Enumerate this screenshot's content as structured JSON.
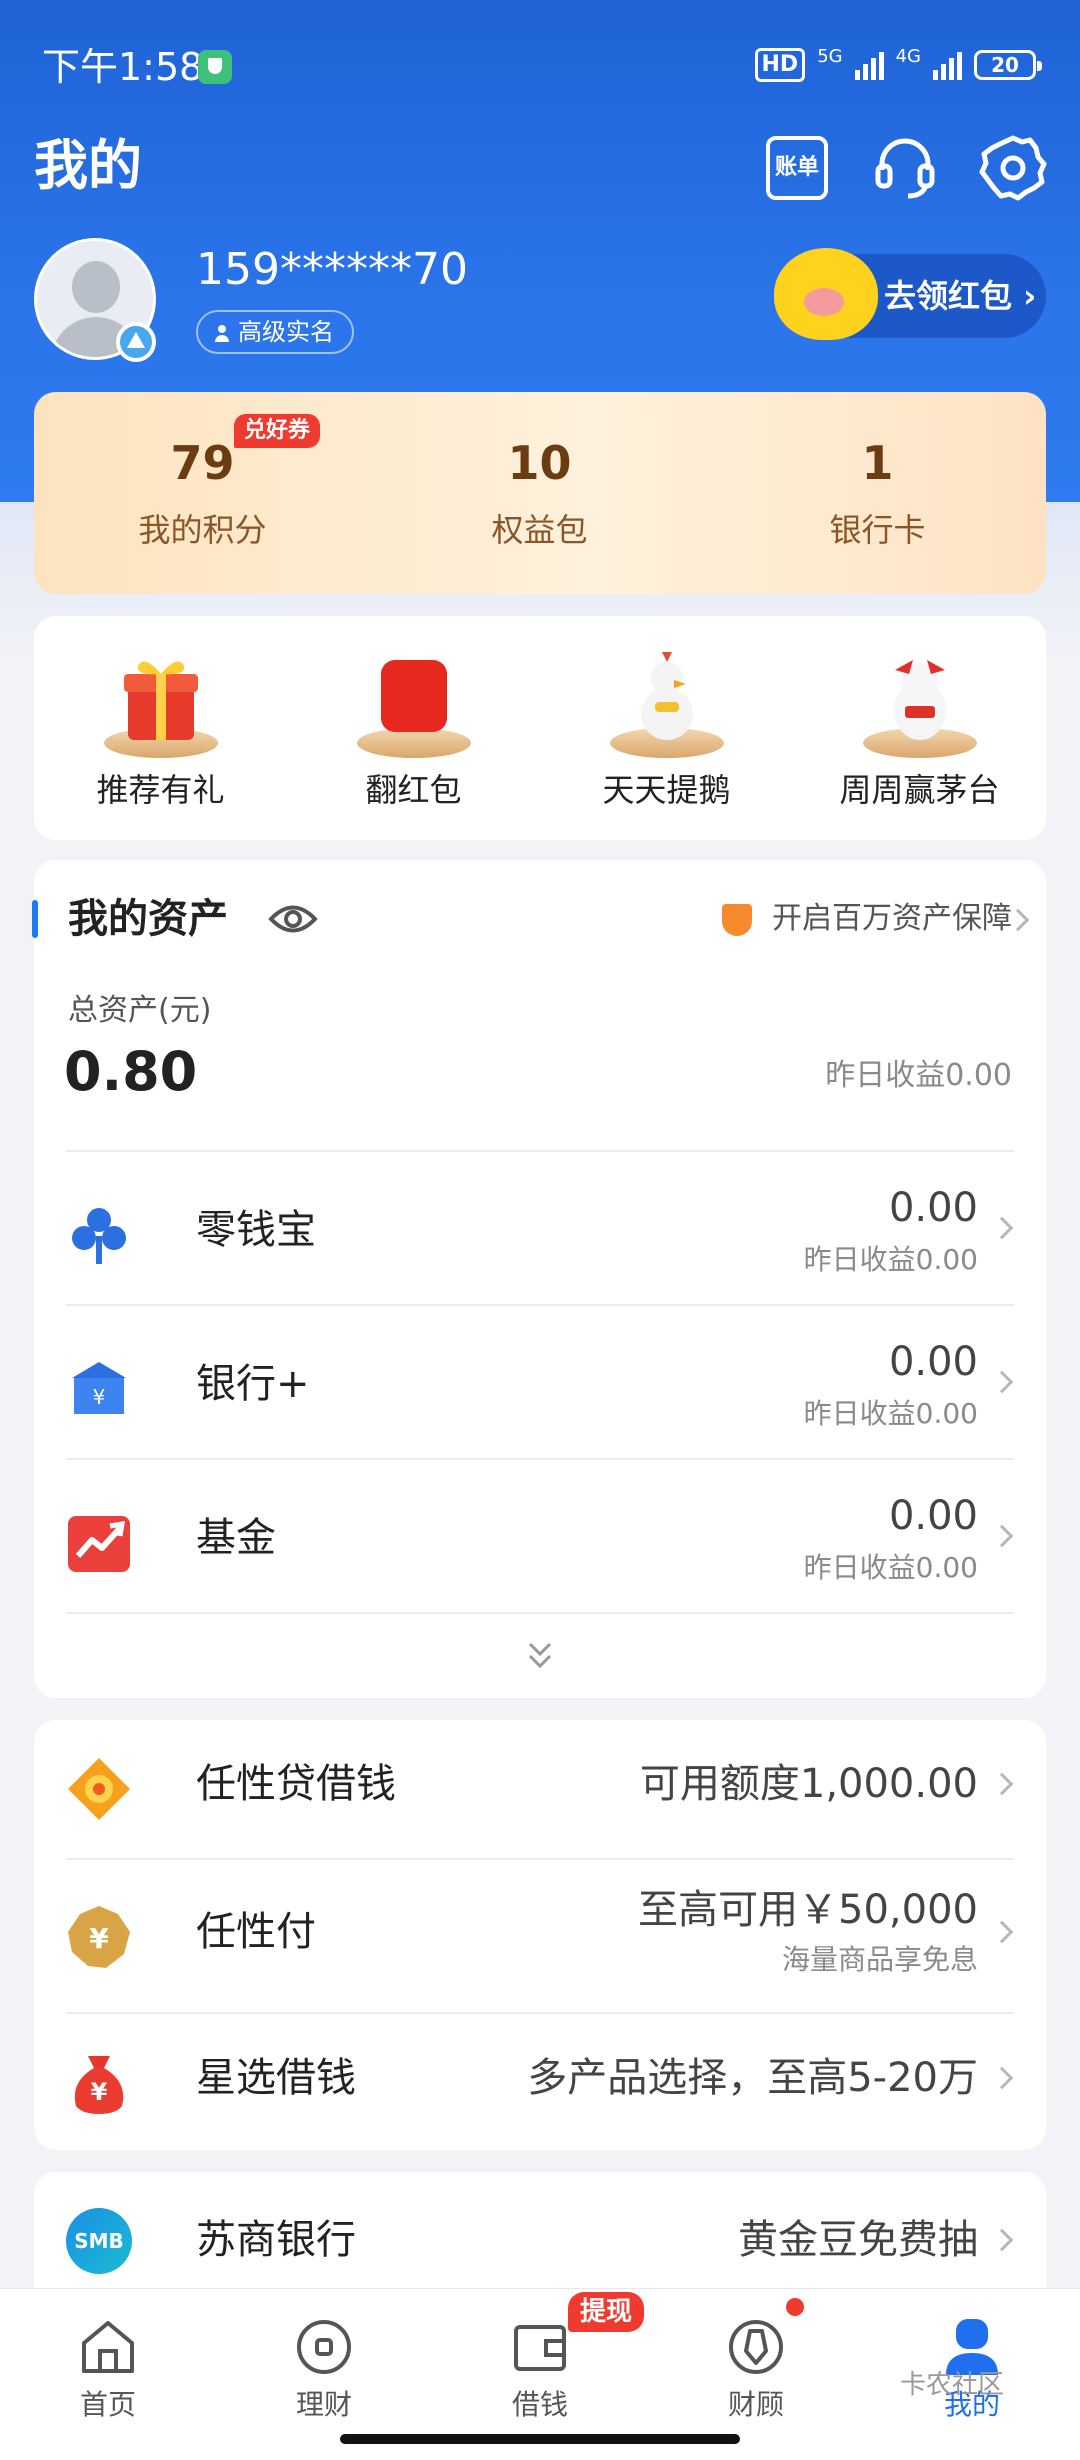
{
  "status_bar": {
    "time": "下午1:58",
    "hd": "HD",
    "network_1": "5G",
    "network_2": "4G",
    "battery": "20"
  },
  "header": {
    "title": "我的",
    "bill_label": "账单"
  },
  "profile": {
    "phone": "159******70",
    "verify_label": "高级实名",
    "redpacket_label": "去领红包"
  },
  "stats": [
    {
      "value": "79",
      "label": "我的积分",
      "badge": "兑好券"
    },
    {
      "value": "10",
      "label": "权益包"
    },
    {
      "value": "1",
      "label": "银行卡"
    }
  ],
  "activities": [
    {
      "label": "推荐有礼"
    },
    {
      "label": "翻红包"
    },
    {
      "label": "天天提鹅"
    },
    {
      "label": "周周赢茅台"
    }
  ],
  "assets": {
    "title": "我的资产",
    "guard_label": "开启百万资产保障",
    "total_label": "总资产(元)",
    "total_value": "0.80",
    "yesterday": "昨日收益0.00",
    "items": [
      {
        "name": "零钱宝",
        "value": "0.00",
        "sub": "昨日收益0.00"
      },
      {
        "name": "银行+",
        "value": "0.00",
        "sub": "昨日收益0.00"
      },
      {
        "name": "基金",
        "value": "0.00",
        "sub": "昨日收益0.00"
      }
    ]
  },
  "loans": [
    {
      "name": "任性贷借钱",
      "value": "可用额度1,000.00"
    },
    {
      "name": "任性付",
      "value": "至高可用￥50,000",
      "sub": "海量商品享免息"
    },
    {
      "name": "星选借钱",
      "value": "多产品选择，至高5-20万"
    }
  ],
  "bank": {
    "name": "苏商银行",
    "value": "黄金豆免费抽",
    "logo": "SMB"
  },
  "nav": [
    {
      "label": "首页"
    },
    {
      "label": "理财"
    },
    {
      "label": "借钱",
      "badge": "提现"
    },
    {
      "label": "财顾"
    },
    {
      "label": "我的"
    }
  ],
  "watermark": "卡农社区",
  "colors": {
    "primary": "#2b74ea",
    "accent_red": "#e8432d",
    "gold": "#6b3c12"
  }
}
